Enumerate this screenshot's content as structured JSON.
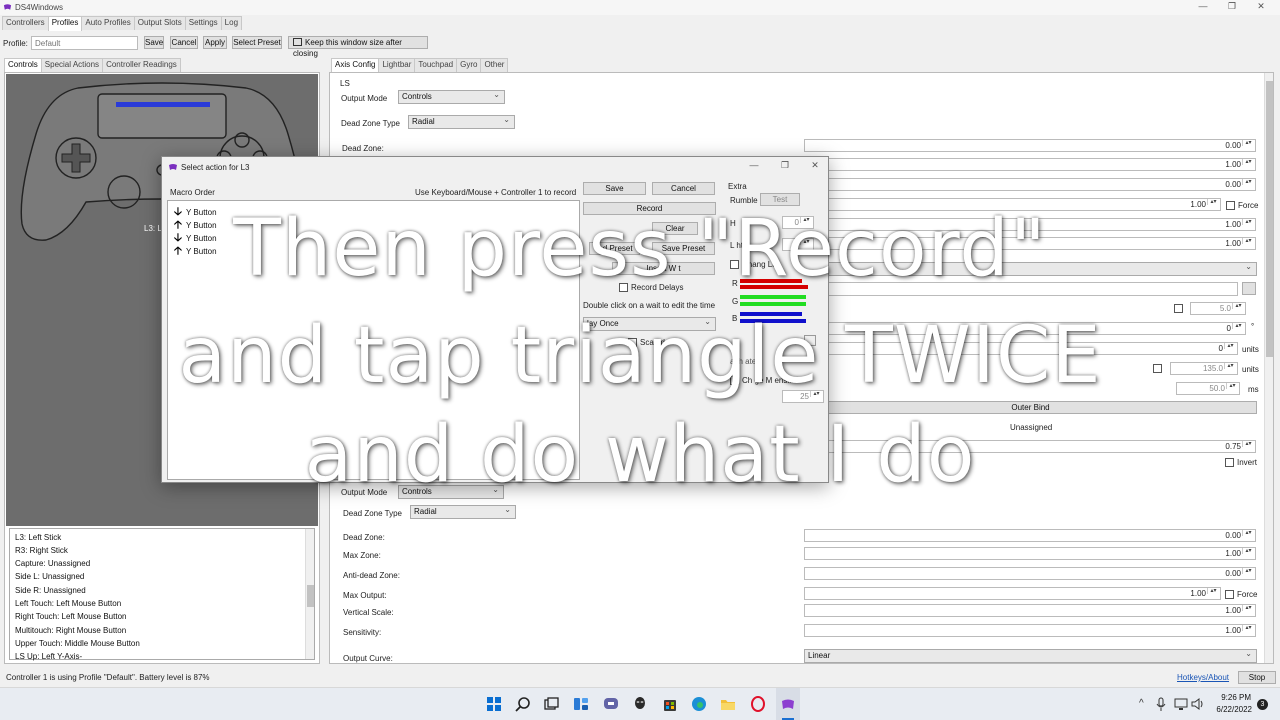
{
  "window": {
    "title": "DS4Windows",
    "minimize": "—",
    "restore": "❐",
    "close": "✕"
  },
  "main_tabs": [
    {
      "label": "Controllers",
      "active": false
    },
    {
      "label": "Profiles",
      "active": true
    },
    {
      "label": "Auto Profiles",
      "active": false
    },
    {
      "label": "Output Slots",
      "active": false
    },
    {
      "label": "Settings",
      "active": false
    },
    {
      "label": "Log",
      "active": false
    }
  ],
  "profile_bar": {
    "label": "Profile:",
    "placeholder": "Default",
    "save": "Save",
    "cancel": "Cancel",
    "apply": "Apply",
    "select_preset": "Select Preset",
    "keep_size": "Keep this window size after closing"
  },
  "left_tabs": [
    {
      "label": "Controls",
      "active": true
    },
    {
      "label": "Special Actions",
      "active": false
    },
    {
      "label": "Controller Readings",
      "active": false
    }
  ],
  "controller_hover_label": "L3: L",
  "bindings": [
    "L3: Left Stick",
    "R3: Right Stick",
    "Capture: Unassigned",
    "Side L: Unassigned",
    "Side R: Unassigned",
    "Left Touch: Left Mouse Button",
    "Right Touch: Left Mouse Button",
    "Multitouch: Right Mouse Button",
    "Upper Touch: Middle Mouse Button",
    "LS Up: Left Y-Axis-"
  ],
  "right_tabs": [
    {
      "label": "Axis Config",
      "active": true
    },
    {
      "label": "Lightbar",
      "active": false
    },
    {
      "label": "Touchpad",
      "active": false
    },
    {
      "label": "Gyro",
      "active": false
    },
    {
      "label": "Other",
      "active": false
    }
  ],
  "ls": {
    "group_label": "LS",
    "output_mode_label": "Output Mode",
    "output_mode_value": "Controls",
    "dead_zone_type_label": "Dead Zone Type",
    "dead_zone_type_value": "Radial",
    "dead_zone_label": "Dead Zone:",
    "values": [
      "0.00",
      "1.00",
      "0.00",
      "1.00",
      "1.00",
      "1.00"
    ],
    "force_label": "Force",
    "extra_values": [
      "5.0",
      "0",
      "0",
      "135.0",
      "50.0"
    ],
    "degree_unit": "°",
    "units_label": "units",
    "ms_label": "ms",
    "outer_bind_label": "Outer Bind",
    "outer_bind_value": "Unassigned",
    "outer_bind_value2": "0.75",
    "invert_label": "Invert"
  },
  "rs": {
    "output_mode_label": "Output Mode",
    "output_mode_value": "Controls",
    "dead_zone_type_label": "Dead Zone Type",
    "dead_zone_type_value": "Radial",
    "rows": [
      {
        "label": "Dead Zone:",
        "value": "0.00"
      },
      {
        "label": "Max Zone:",
        "value": "1.00"
      },
      {
        "label": "Anti-dead Zone:",
        "value": "0.00"
      },
      {
        "label": "Max Output:",
        "value": "1.00"
      },
      {
        "label": "Vertical Scale:",
        "value": "1.00"
      },
      {
        "label": "Sensitivity:",
        "value": "1.00"
      }
    ],
    "force_label": "Force",
    "output_curve_label": "Output Curve:",
    "output_curve_value": "Linear"
  },
  "status": {
    "text": "Controller 1 is using Profile \"Default\". Battery level is 87%",
    "hotkeys_link": "Hotkeys/About",
    "stop_button": "Stop"
  },
  "taskbar": {
    "time": "9:26 PM",
    "date": "6/22/2022",
    "notification_count": "3",
    "chevron": "^"
  },
  "dialog": {
    "title": "Select action for L3",
    "macro_order_label": "Macro Order",
    "record_hint": "Use Keyboard/Mouse + Controller 1 to record",
    "macro_items": [
      {
        "arrow": "🡣",
        "label": "Y Button"
      },
      {
        "arrow": "🡡",
        "label": "Y Button"
      },
      {
        "arrow": "🡣",
        "label": "Y Button"
      },
      {
        "arrow": "🡡",
        "label": "Y Button"
      }
    ],
    "save": "Save",
    "cancel": "Cancel",
    "record": "Record",
    "clear": "Clear",
    "load_preset": "L  d Preset",
    "save_preset": "Save Preset",
    "insert_wait": "Insert W  t",
    "record_delays": "Record Delays",
    "wait_hint": "Double click on a wait to edit the time",
    "play_mode": "  lay Once",
    "scan_code": "Sca    ode",
    "extra_label": "Extra",
    "rumble_label": "Rumble",
    "test_button": "Test",
    "heavy_short": "H",
    "light_short": "L  ht",
    "rumble_heavy": "0",
    "rumble_light": "0",
    "change_light": "Chang   Lig",
    "r": "R",
    "g": "G",
    "b": "B",
    "flash_rate": "  ash   ate",
    "change_mouse_sens": "Ch ge M      ensitiv",
    "mouse_sens_value": "25",
    "colors": {
      "r": "#d40000",
      "g": "#22dd22",
      "b": "#1010cc"
    }
  },
  "overlay": {
    "line1": "Then press \"Record\"",
    "line2": "and tap triangle TWICE",
    "line3": "and do what I do"
  }
}
